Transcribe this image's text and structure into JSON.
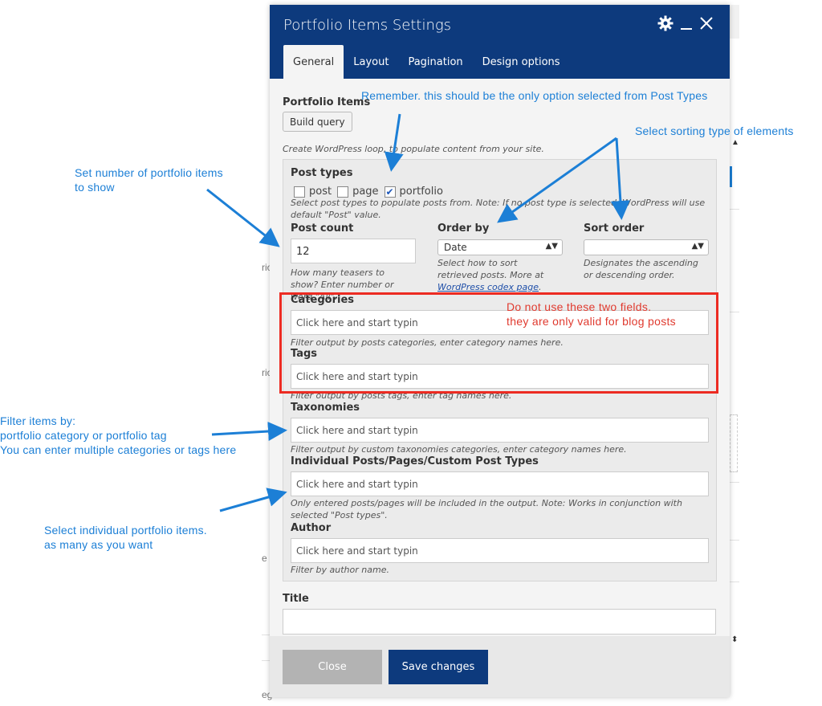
{
  "modal": {
    "title": "Portfolio Items Settings",
    "icons": {
      "settings": "gear-icon",
      "minimize": "minimize-icon",
      "close": "close-icon"
    },
    "tabs": [
      {
        "label": "General",
        "active": true
      },
      {
        "label": "Layout"
      },
      {
        "label": "Pagination"
      },
      {
        "label": "Design options"
      }
    ]
  },
  "general": {
    "section_label": "Portfolio Items",
    "build_query": "Build query",
    "build_help": "Create WordPress loop, to populate content from your site.",
    "post_types": {
      "label": "Post types",
      "options": [
        {
          "label": "post",
          "checked": false
        },
        {
          "label": "page",
          "checked": false
        },
        {
          "label": "portfolio",
          "checked": true
        }
      ],
      "help": "Select post types to populate posts from. Note: If no post type is selected, WordPress will use default \"Post\" value."
    },
    "post_count": {
      "label": "Post count",
      "value": "12",
      "help": "How many teasers to show? Enter number or word \"All\"."
    },
    "order_by": {
      "label": "Order by",
      "value": "Date",
      "help_prefix": "Select how to sort retrieved posts. More at ",
      "help_link": "WordPress codex page",
      "help_suffix": "."
    },
    "sort_order": {
      "label": "Sort order",
      "value": "",
      "help": "Designates the ascending or descending order."
    },
    "categories": {
      "label": "Categories",
      "placeholder": "Click here and start typin",
      "help": "Filter output by posts categories, enter category names here."
    },
    "tags": {
      "label": "Tags",
      "placeholder": "Click here and start typin",
      "help": "Filter output by posts tags, enter tag names here."
    },
    "taxonomies": {
      "label": "Taxonomies",
      "placeholder": "Click here and start typin",
      "help": "Filter output by custom taxonomies categories, enter category names here."
    },
    "individual": {
      "label": "Individual Posts/Pages/Custom Post Types",
      "placeholder": "Click here and start typin",
      "help": "Only entered posts/pages will be included in the output. Note: Works in conjunction with selected \"Post types\"."
    },
    "author": {
      "label": "Author",
      "placeholder": "Click here and start typin",
      "help": "Filter by author name."
    },
    "title": {
      "label": "Title",
      "value": ""
    }
  },
  "footer": {
    "close": "Close",
    "save": "Save changes"
  },
  "annotations": {
    "remember": "Remember. this should be the only option selected from Post Types",
    "sorting": "Select sorting type of elements",
    "post_count_l1": "Set number of portfolio items",
    "post_count_l2": "to show",
    "filter_l1": "Filter items by:",
    "filter_l2": "portfolio category or portfolio tag",
    "filter_l3": "You can enter multiple categories or tags here",
    "individual_l1": "Select individual portfolio items.",
    "individual_l2": "as many as you want",
    "warn_l1": "Do not use these two fields.",
    "warn_l2": "they are only valid for blog posts"
  },
  "background": {
    "frag1": "rio",
    "frag2": "rio",
    "frag3": "e",
    "frag4": "eg"
  },
  "colors": {
    "header": "#0d3a7d",
    "annotation_blue": "#1c7fd6",
    "annotation_red": "#ec2b22"
  }
}
